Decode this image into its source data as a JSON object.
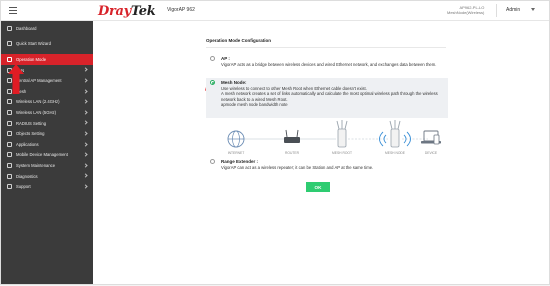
{
  "header": {
    "logo_part1": "Dray",
    "logo_part2": "Tek",
    "model": "VigorAP 962",
    "device_line1": "AP962-PL-LO",
    "device_line2": "MeshNode(Wireless)",
    "user": "Admin"
  },
  "sidebar": {
    "items": [
      {
        "label": "Dashboard"
      },
      {
        "label": "Quick Start Wizard"
      },
      {
        "label": "Operation Mode"
      },
      {
        "label": "LAN"
      },
      {
        "label": "Central AP Management"
      },
      {
        "label": "Mesh"
      },
      {
        "label": "Wireless LAN (2.4GHz)"
      },
      {
        "label": "Wireless LAN (5GHz)"
      },
      {
        "label": "RADIUS Setting"
      },
      {
        "label": "Objects Setting"
      },
      {
        "label": "Applications"
      },
      {
        "label": "Mobile Device Management"
      },
      {
        "label": "System Maintenance"
      },
      {
        "label": "Diagnostics"
      },
      {
        "label": "Support"
      }
    ],
    "active_index": 2
  },
  "content": {
    "section_title": "Operation Mode Configuration",
    "options": [
      {
        "name": "AP :",
        "desc": "VigorAP acts as a bridge between wireless devices and wired Ethernet network, and exchanges data between them.",
        "selected": false
      },
      {
        "name": "Mesh Node:",
        "desc1": "Use wireless to connect to other Mesh Root when Ethernet cable doesn't exist.",
        "desc2": "A mesh network creates a set of links automatically and calculate the most optimal wireless path through the wireless network back to a wired Mesh Root.",
        "desc3": "apmode mesh node bandwidth note",
        "selected": true
      },
      {
        "name": "Range Extender :",
        "desc": "VigorAP can act as a wireless repeater; it can be Station and AP at the same time.",
        "selected": false
      }
    ],
    "diagram_labels": [
      "INTERNET",
      "ROUTER",
      "MESH ROOT",
      "MESH NODE",
      "DEVICE"
    ],
    "ok_label": "OK"
  },
  "annotations": {
    "step2": "2",
    "step3": "3",
    "color": "#e01c24"
  },
  "colors": {
    "sidebar_bg": "#3b3b3b",
    "active": "#d8232a",
    "ok_button": "#2ecc71",
    "selected_radio": "#27ae60"
  }
}
